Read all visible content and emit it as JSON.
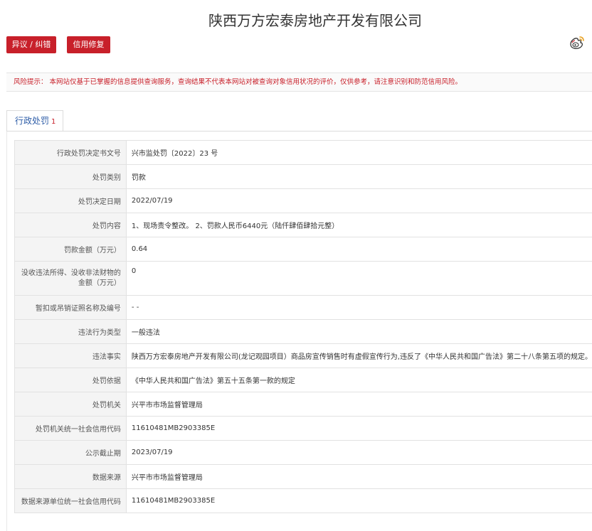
{
  "page": {
    "title": "陕西万方宏泰房地产开发有限公司"
  },
  "actions": {
    "dispute_label": "异议 / 纠错",
    "credit_repair_label": "信用修复"
  },
  "share": {
    "icon": "weibo-icon"
  },
  "risk_notice": {
    "text": "风险提示： 本网站仅基于已掌握的信息提供查询服务，查询结果不代表本网站对被查询对象信用状况的评价，仅供参考，请注意识别和防范信用风险。"
  },
  "tabs": [
    {
      "label": "行政处罚",
      "count": "1"
    }
  ],
  "colors": {
    "accent": "#c8202a",
    "tab_text": "#2f5ea8",
    "label_bg": "#f4f4f4"
  },
  "details": [
    {
      "label": "行政处罚决定书文号",
      "value": "兴市监处罚〔2022〕23 号"
    },
    {
      "label": "处罚类别",
      "value": "罚款"
    },
    {
      "label": "处罚决定日期",
      "value": "2022/07/19"
    },
    {
      "label": "处罚内容",
      "value": "1、现场责令整改。 2、罚款人民币6440元（陆仟肆佰肆拾元整）"
    },
    {
      "label": "罚款金额（万元）",
      "value": "0.64"
    },
    {
      "label": "没收违法所得、没收非法财物的金额（万元）",
      "value": "0"
    },
    {
      "label": "暂扣或吊销证照名称及编号",
      "value": "- -"
    },
    {
      "label": "违法行为类型",
      "value": "一般违法"
    },
    {
      "label": "违法事实",
      "value": "陕西万方宏泰房地产开发有限公司(龙记观园项目）商品房宣传销售时有虚假宣传行为,违反了《中华人民共和国广告法》第二十八条第五项的规定。"
    },
    {
      "label": "处罚依据",
      "value": "《中华人民共和国广告法》第五十五条第一款的规定"
    },
    {
      "label": "处罚机关",
      "value": "兴平市市场监督管理局"
    },
    {
      "label": "处罚机关统一社会信用代码",
      "value": "11610481MB2903385E"
    },
    {
      "label": "公示截止期",
      "value": "2023/07/19"
    },
    {
      "label": "数据来源",
      "value": "兴平市市场监督管理局"
    },
    {
      "label": "数据来源单位统一社会信用代码",
      "value": "11610481MB2903385E"
    }
  ]
}
